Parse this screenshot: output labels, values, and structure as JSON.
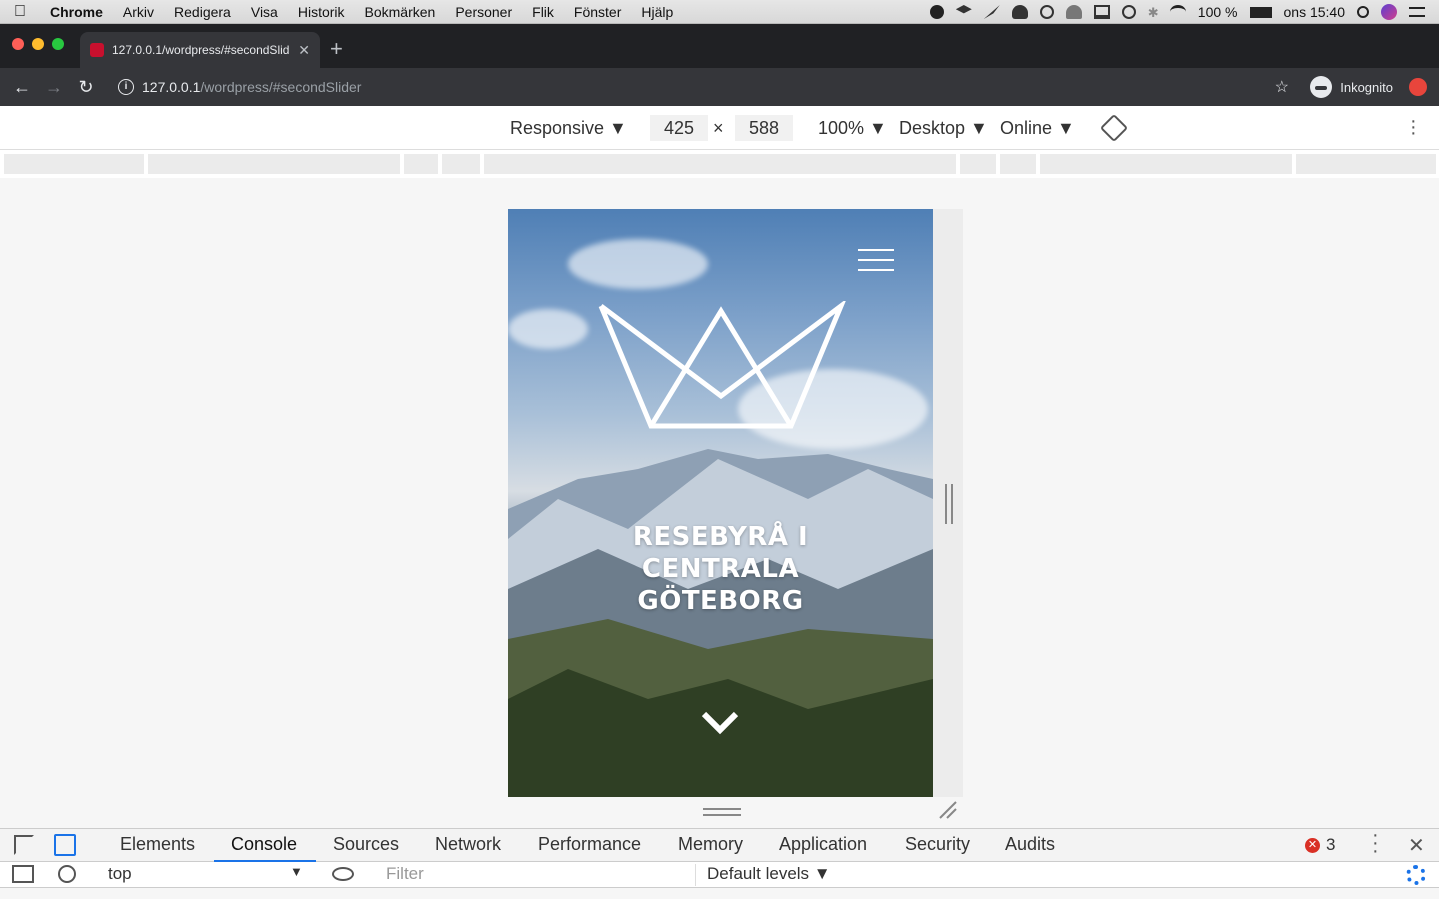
{
  "menubar": {
    "app": "Chrome",
    "items": [
      "Arkiv",
      "Redigera",
      "Visa",
      "Historik",
      "Bokmärken",
      "Personer",
      "Flik",
      "Fönster",
      "Hjälp"
    ],
    "battery": "100 %",
    "clock": "ons 15:40"
  },
  "browser": {
    "tab_title": "127.0.0.1/wordpress/#secondSlid",
    "url_host": "127.0.0.1",
    "url_path": "/wordpress/#secondSlider",
    "profile_label": "Inkognito"
  },
  "device_toolbar": {
    "mode": "Responsive ▼",
    "width": "425",
    "height": "588",
    "times": "×",
    "zoom": "100% ▼",
    "ua": "Desktop ▼",
    "network": "Online ▼"
  },
  "page": {
    "hero_line1": "RESEBYRÅ I",
    "hero_line2": "CENTRALA",
    "hero_line3": "GÖTEBORG"
  },
  "devtools": {
    "tabs": [
      "Elements",
      "Console",
      "Sources",
      "Network",
      "Performance",
      "Memory",
      "Application",
      "Security",
      "Audits"
    ],
    "active_tab": "Console",
    "error_count": "3",
    "context": "top",
    "filter_placeholder": "Filter",
    "levels": "Default levels ▼"
  },
  "colors": {
    "accent": "#1a73e8",
    "error": "#d93025",
    "browser_dark": "#35363a"
  }
}
